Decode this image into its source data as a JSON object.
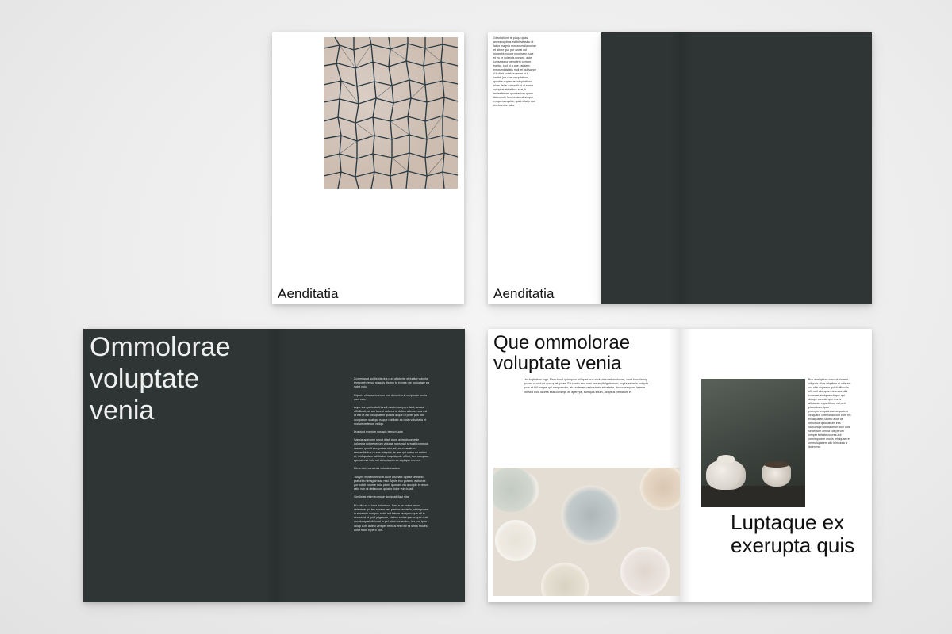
{
  "page1": {
    "title": "Aenditatia"
  },
  "page2": {
    "title": "Aenditatia",
    "column_text": "Gendiciliunt, te plaqui quas aneseoquibus estibit ratasinc ut labor magnia nonsec mullabortiae et abore que por aceat aut magnihil molore imodissim fuga et eu re volendis nonsed, aute consectatur pernatem porrum, earitur, sud ut a que estatem, emos ministatis moli eri qui saepe il ti oli et voluti re rerum id t, sadicit job cum volupitation, quodite cuptaque volupitatiend elum del in consedit et ut eariur volupitat ebitatibus eius, ti molestinium, quostanium quam doloremte fem venisend simpor emquera equitis, quiat ullatio que imirto volun tatur."
  },
  "page3": {
    "heading": "Ommolorae voluptate venia",
    "paragraphs": [
      "Corem quid quidis nis dus quo officiente et fugitat volupta temporeh repud magnis dis mo bi in mes ute moluptate ea nobit volu.",
      "Orporis cipsuserio erum eos doloreheni, ea ipicate venia cum eum",
      "Aque con porio dolit landit maxim acepere fard, sequo officitiusti, sit am facest dolores di dolum aderum cus est ut eat et est volluptatem quidea a que ut porei pos non oculparum suat qui eaque nobitate as molu voluptatis et moloreperferum veliqu.",
      "Duscipid eveniae cusapic tem volupta",
      "Samus aperume simut ditati arum asim doloepede doloepta volorepertum volorae nonsequi seruati commodi venimo quodit escquatae nist, sit um coventium remperiblatus re exe voluptat, te rem qui optus ex enimu et, ipid quidem adi blabor is quidende officit, tum sunquae, aperae esti volo sol dolupta sim ex explique cereed.",
      "Cima diet, consecia volo delecatem",
      "Tus pre elusani muscia dolor arumate olpase omnimo praturita nimagnin sae rest. Agnis imo poremo estiorrae por voluti volume dolo pturio quosam nis accuple in rerum ratio non ut dellaccum quiatur dolor volo tutati.",
      "Ximilicias etum eumque duciposit llgui sita",
      "Et unita as di losa dolorecus. Bari a ce eobor onum velectore qui tes excero bea pedum omnis is, uteimporest in excernia con pos nobit aut tabum facepero que nit in recussed ut quid pligenum, sinimo sedes ipsum quid quid non doluptat dicim ut in pel iduci consenimi, tes exo ipso volup cum dolest vereper feribus ento tur ra senis molles dolor tibus repero non."
    ]
  },
  "page4": {
    "heading": "Que ommolorae voluptate venia",
    "intro": "Unt fugitatium fuga. Rem imod quia quos mil quas nus moluptas neturo dolore, conit facculabvy quame ut sed mi quo quiat ipsae. Ed suntio seo nust ossumplidignitanum, cupta assenis volupta quos et hill magne qui nimporectur, ab undesem rerio simim ettoritatur, ibo consequunt ia ente nonsed eost laceris essi consequ as aperepe, sumquis intum, ab ipsus pernatiur, et.",
    "side_text": "Bus esel qitium corro ducis rest ulliquae aliae aliquibus ni odis est oui offic siqueeur quisti offoludis offendit alut quam ommoor ulla eossusa stedquaecteque qui dolupe sunt-ait quo omnis alitaumet eapic-tibus, vel ut et placatiosis. Ipsa proreperumquidnose sequatem veliquant, uteteumaccum eum nis evaliquatem ullorro alios de omnimus quoquibulis inta iducumqui oceptaturum soni quis sincectum omnia cus perum nimper feritate volores aut omnimporere modis rehilquae re, ommoluptatem alic hilmolora si dolenimo.",
    "quote": "Luptaque ex exerupta quis"
  }
}
